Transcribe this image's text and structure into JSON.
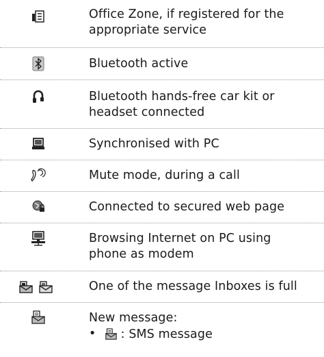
{
  "rows": [
    {
      "icon": "office-zone-icon",
      "description": "Office Zone, if registered for the appropriate service"
    },
    {
      "icon": "bluetooth-icon",
      "description": "Bluetooth active"
    },
    {
      "icon": "headset-icon",
      "description": "Bluetooth hands-free car kit or headset connected"
    },
    {
      "icon": "pc-sync-icon",
      "description": "Synchronised with PC"
    },
    {
      "icon": "mute-icon",
      "description": "Mute mode, during a call"
    },
    {
      "icon": "secure-web-icon",
      "description": "Connected to secured web page"
    },
    {
      "icon": "pc-modem-icon",
      "description": "Browsing Internet on PC using phone as modem"
    },
    {
      "icon": "inbox-full-icon",
      "description": "One of the message Inboxes is full"
    },
    {
      "icon": "new-message-icon",
      "description": "New message:",
      "bullet_symbol": "•",
      "bullet_text": ": SMS message"
    }
  ]
}
